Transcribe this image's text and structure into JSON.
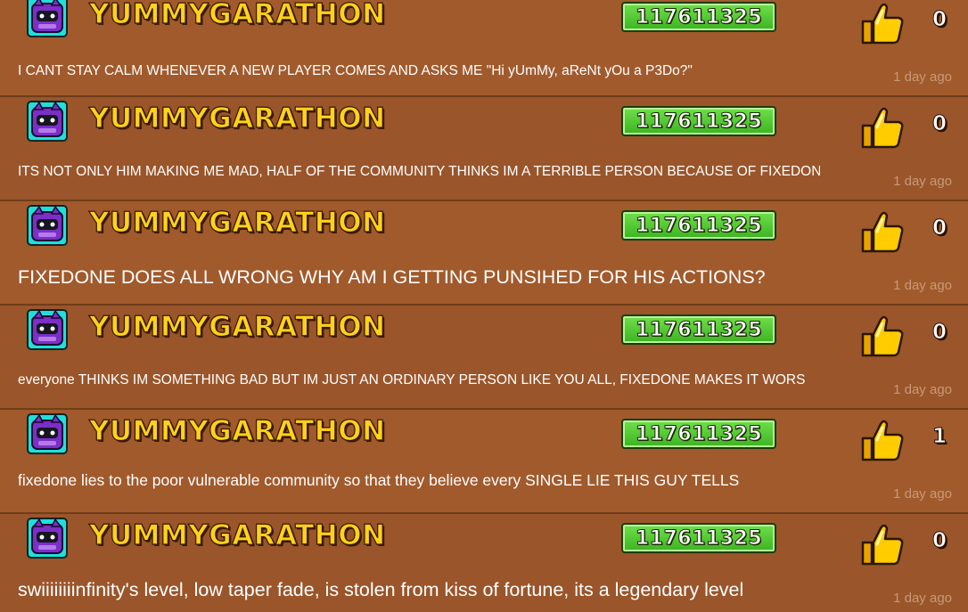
{
  "colors": {
    "background_odd": "#a15a2c",
    "background_even": "#9a552a",
    "username": "#ffd21a",
    "badge": "#4ccb2e",
    "age_text": "#c79a77"
  },
  "comments": [
    {
      "username": "YUMMYGARATHON",
      "badge_id": "117611325",
      "likes": "0",
      "text": "I CANT STAY CALM WHENEVER A NEW PLAYER COMES AND ASKS ME \"Hi yUmMy, aReNt yOu a P3Do?\"",
      "age": "1 day ago",
      "icon": "like-icon"
    },
    {
      "username": "YUMMYGARATHON",
      "badge_id": "117611325",
      "likes": "0",
      "text": "ITS NOT ONLY HIM MAKING ME MAD, HALF OF THE COMMUNITY THINKS IM A TERRIBLE PERSON BECAUSE OF FIXEDON",
      "age": "1 day ago",
      "icon": "like-icon"
    },
    {
      "username": "YUMMYGARATHON",
      "badge_id": "117611325",
      "likes": "0",
      "text": "FIXEDONE DOES ALL WRONG WHY AM I GETTING PUNSIHED FOR HIS ACTIONS?",
      "age": "1 day ago",
      "icon": "like-icon"
    },
    {
      "username": "YUMMYGARATHON",
      "badge_id": "117611325",
      "likes": "0",
      "text": "everyone THINKS IM SOMETHING BAD BUT IM JUST AN ORDINARY PERSON LIKE YOU ALL, FIXEDONE MAKES IT WORS",
      "age": "1 day ago",
      "icon": "like-icon"
    },
    {
      "username": "YUMMYGARATHON",
      "badge_id": "117611325",
      "likes": "1",
      "text": "fixedone lies to the poor vulnerable community so that they believe every SINGLE LIE THIS GUY TELLS",
      "age": "1 day ago",
      "icon": "like-icon"
    },
    {
      "username": "YUMMYGARATHON",
      "badge_id": "117611325",
      "likes": "0",
      "text": "swiiiiiiiinfinity's level, low taper fade, is stolen from kiss of fortune, its a legendary level",
      "age": "1 day ago",
      "icon": "like-icon"
    }
  ]
}
